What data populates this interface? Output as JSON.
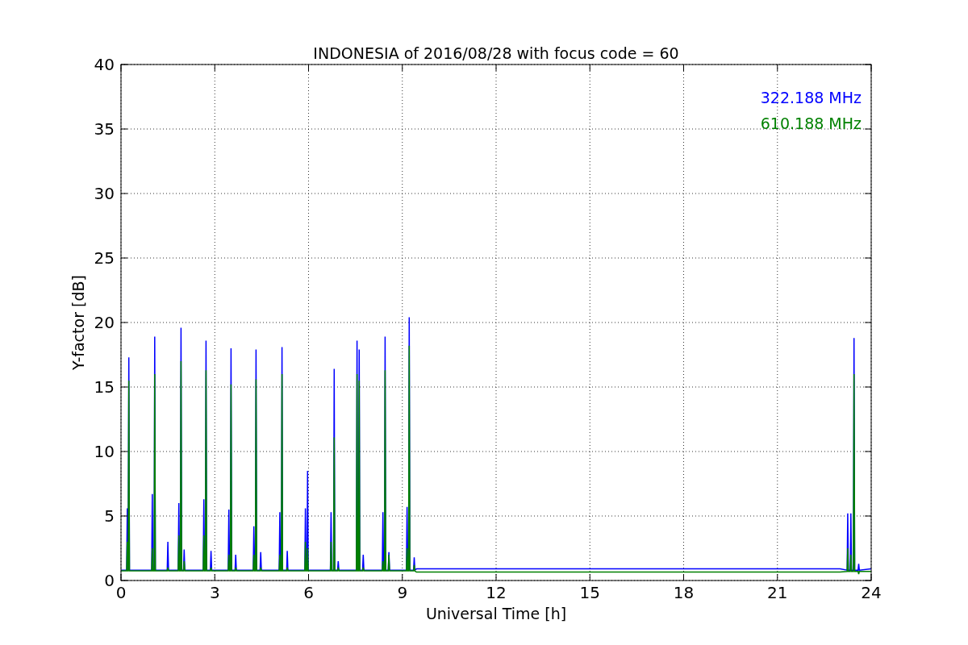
{
  "figure": {
    "chart_data": {
      "type": "line",
      "grid": true,
      "title": "INDONESIA of 2016/08/28 with focus code = 60",
      "xlabel": "Universal Time [h]",
      "ylabel": "Y-factor [dB]",
      "xlim": [
        0,
        24
      ],
      "ylim": [
        0,
        40
      ],
      "xticks": [
        0,
        3,
        6,
        9,
        12,
        15,
        18,
        21,
        24
      ],
      "yticks": [
        0,
        5,
        10,
        15,
        20,
        25,
        30,
        35,
        40
      ],
      "x": [
        0,
        0.18,
        0.2,
        0.22,
        0.23,
        0.25,
        0.27,
        0.98,
        1.0,
        1.02,
        1.06,
        1.08,
        1.1,
        1.48,
        1.5,
        1.52,
        1.83,
        1.85,
        1.87,
        1.9,
        1.92,
        1.94,
        2.0,
        2.02,
        2.04,
        2.63,
        2.65,
        2.67,
        2.7,
        2.72,
        2.74,
        2.86,
        2.88,
        2.9,
        3.43,
        3.45,
        3.47,
        3.5,
        3.52,
        3.54,
        3.65,
        3.67,
        3.69,
        4.23,
        4.25,
        4.27,
        4.3,
        4.32,
        4.34,
        4.45,
        4.47,
        4.49,
        5.06,
        5.08,
        5.1,
        5.13,
        5.15,
        5.17,
        5.3,
        5.32,
        5.34,
        5.88,
        5.9,
        5.92,
        5.95,
        5.97,
        5.99,
        6.7,
        6.72,
        6.74,
        6.8,
        6.82,
        6.84,
        6.93,
        6.95,
        6.97,
        7.53,
        7.55,
        7.57,
        7.6,
        7.62,
        7.64,
        7.73,
        7.75,
        7.77,
        8.36,
        8.38,
        8.4,
        8.43,
        8.45,
        8.47,
        8.55,
        8.57,
        8.59,
        9.13,
        9.15,
        9.17,
        9.2,
        9.22,
        9.24,
        9.36,
        9.38,
        9.4,
        9.45,
        23.0,
        23.23,
        23.25,
        23.27,
        23.33,
        23.35,
        23.37,
        23.43,
        23.45,
        23.47,
        23.58,
        23.6,
        23.62,
        24
      ],
      "series": [
        {
          "name": "322.188 MHz",
          "color": "#0000ff",
          "values": [
            0.8,
            0.8,
            5.6,
            0.8,
            0.8,
            17.3,
            0.8,
            0.8,
            6.7,
            0.8,
            0.8,
            18.9,
            0.8,
            0.8,
            3,
            0.8,
            0.8,
            6,
            0.8,
            0.8,
            19.6,
            0.8,
            0.8,
            2.4,
            0.8,
            0.8,
            6.3,
            0.8,
            0.8,
            18.6,
            0.8,
            0.8,
            2.3,
            0.8,
            0.8,
            5.5,
            0.8,
            0.8,
            18,
            0.8,
            0.8,
            2,
            0.8,
            0.8,
            4.2,
            0.8,
            0.8,
            17.9,
            0.8,
            0.8,
            2.2,
            0.8,
            0.8,
            5.3,
            0.8,
            0.8,
            18.1,
            0.8,
            0.8,
            2.3,
            0.8,
            0.8,
            5.6,
            0.8,
            0.8,
            8.5,
            0.8,
            0.8,
            5.3,
            0.8,
            0.8,
            16.4,
            0.8,
            0.8,
            1.5,
            0.8,
            0.8,
            18.6,
            0.8,
            0.8,
            17.9,
            0.8,
            0.8,
            2,
            0.8,
            0.8,
            5.3,
            0.8,
            0.8,
            18.9,
            0.8,
            0.8,
            2.2,
            0.8,
            0.8,
            5.7,
            0.8,
            0.8,
            20.4,
            0.8,
            0.8,
            1.8,
            0.8,
            0.9,
            0.9,
            0.8,
            5.2,
            0.8,
            0.8,
            5.2,
            0.8,
            0.8,
            18.8,
            0.8,
            0.8,
            1.3,
            0.8,
            0.9
          ]
        },
        {
          "name": "610.188 MHz",
          "color": "#008000",
          "values": [
            0.75,
            0.75,
            3,
            0.75,
            0.75,
            15.5,
            0.75,
            0.75,
            2.5,
            0.75,
            0.75,
            16,
            0.75,
            0.75,
            1,
            0.75,
            0.75,
            3.5,
            0.75,
            0.75,
            17,
            0.75,
            0.75,
            1.5,
            0.75,
            0.75,
            3.5,
            0.75,
            0.75,
            16.3,
            0.75,
            0.75,
            1,
            0.75,
            0.75,
            2,
            0.75,
            0.75,
            15.2,
            0.75,
            0.75,
            1,
            0.75,
            0.75,
            2,
            0.75,
            0.75,
            15.6,
            0.75,
            0.75,
            1,
            0.75,
            0.75,
            2,
            0.75,
            0.75,
            16,
            0.75,
            0.75,
            1,
            0.75,
            0.75,
            3,
            0.75,
            0.75,
            2.5,
            0.75,
            0.75,
            3,
            0.75,
            0.75,
            11.1,
            0.75,
            0.75,
            1,
            0.75,
            0.75,
            16,
            0.75,
            0.75,
            15.5,
            0.75,
            0.75,
            1,
            0.75,
            0.75,
            1.5,
            0.75,
            0.75,
            16.3,
            0.75,
            0.75,
            2,
            0.75,
            0.75,
            2.5,
            0.75,
            0.75,
            18.2,
            0.75,
            0.75,
            1.2,
            0.75,
            0.65,
            0.65,
            0.7,
            2.5,
            0.7,
            0.7,
            2,
            0.7,
            0.7,
            16,
            0.7,
            0.7,
            0.5,
            0.7,
            0.7
          ]
        }
      ]
    }
  }
}
